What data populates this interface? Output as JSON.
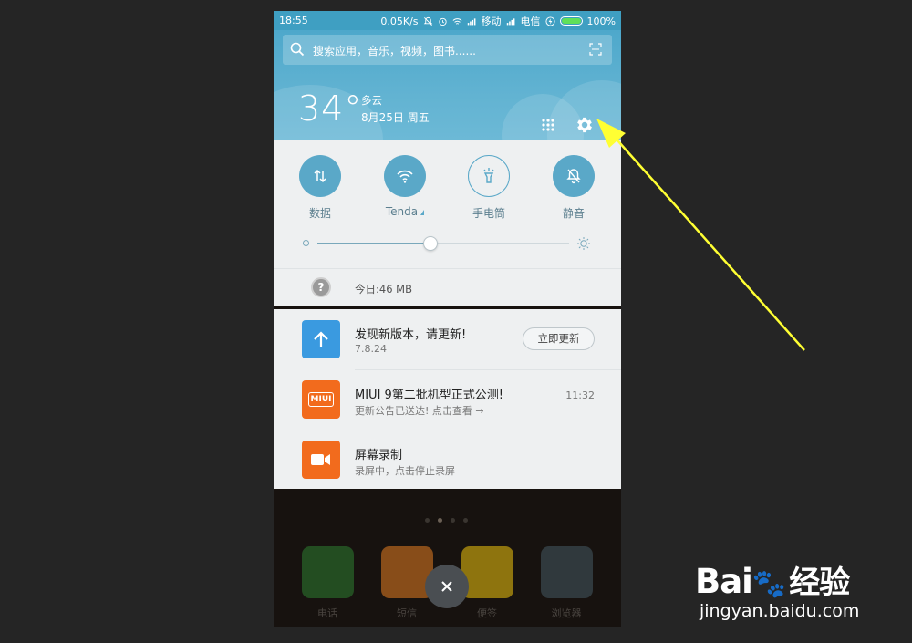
{
  "status_bar": {
    "time": "18:55",
    "speed": "0.05K/s",
    "carrier1": "移动",
    "carrier2": "电信",
    "battery": "100%",
    "battery_level": 1.0
  },
  "search": {
    "placeholder": "搜索应用，音乐，视频，图书......"
  },
  "weather": {
    "temperature": "34°",
    "condition": "多云",
    "date": "8月25日 周五"
  },
  "quick_toggles": [
    {
      "label": "数据",
      "icon": "data-arrows-icon"
    },
    {
      "label": "Tenda",
      "icon": "wifi-icon"
    },
    {
      "label": "手电筒",
      "icon": "flashlight-icon"
    },
    {
      "label": "静音",
      "icon": "mute-bell-icon"
    }
  ],
  "brightness": {
    "level": 0.45
  },
  "data_usage": {
    "icon_text": "?",
    "text": "今日:46 MB"
  },
  "notifications": [
    {
      "title": "发现新版本，请更新!",
      "subtitle": "7.8.24",
      "action": "立即更新",
      "icon": "update-arrow-icon",
      "color": "#3a9ae0"
    },
    {
      "title": "MIUI 9第二批机型正式公测!",
      "subtitle": "更新公告已送达! 点击查看 →",
      "time": "11:32",
      "icon_text": "MIUI",
      "color": "#f26b1d"
    },
    {
      "title": "屏幕录制",
      "subtitle": "录屏中，点击停止录屏",
      "icon": "video-camera-icon",
      "color": "#f26b1d"
    }
  ],
  "dock": [
    {
      "label": "电话",
      "color": "#2e7d32"
    },
    {
      "label": "短信",
      "color": "#e67e22"
    },
    {
      "label": "便签",
      "color": "#f1c40f"
    },
    {
      "label": "浏览器",
      "color": "#455a64"
    }
  ],
  "watermark": {
    "logo": "Bai",
    "logo_suffix": "经验",
    "url": "jingyan.baidu.com"
  },
  "colors": {
    "header": "#4ea8cb",
    "accent": "#5aa8c8",
    "panel": "#eef0f1",
    "arrow": "#ffff33"
  }
}
